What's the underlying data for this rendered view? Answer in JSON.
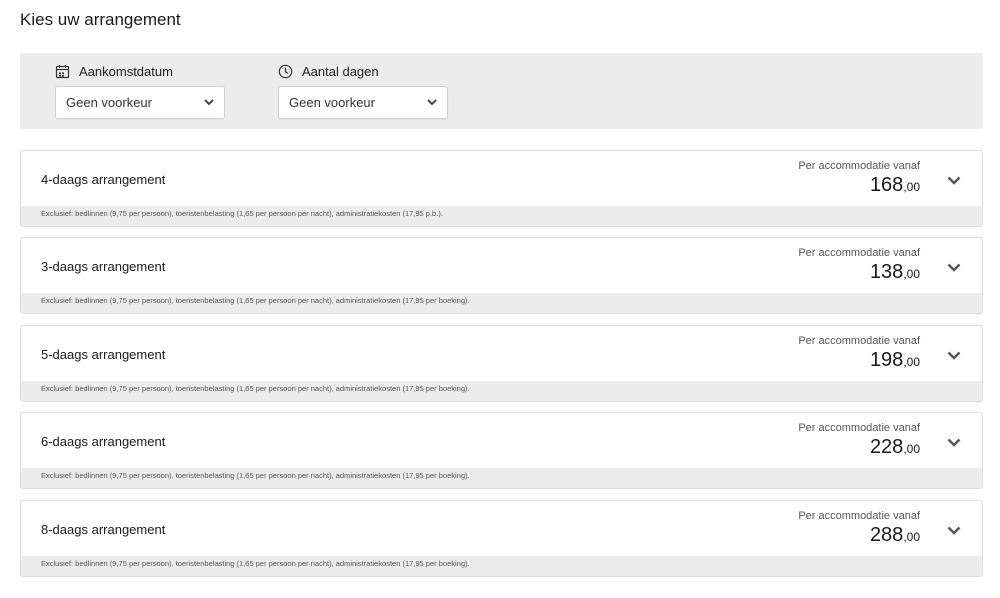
{
  "page": {
    "title": "Kies uw arrangement"
  },
  "filters": {
    "arrival": {
      "label": "Aankomstdatum",
      "icon": "calendar-icon",
      "value": "Geen voorkeur"
    },
    "days": {
      "label": "Aantal dagen",
      "icon": "clock-icon",
      "value": "Geen voorkeur"
    }
  },
  "arrangements": [
    {
      "title": "4-daags arrangement",
      "from_label": "Per accommodatie vanaf",
      "price_main": "168",
      "price_cents": ",00",
      "note": "Exclusief: bedlinnen (9,75 per persoon), toeristenbelasting (1,65 per persoon per nacht), administratiekosten (17,95 p.b.)."
    },
    {
      "title": "3-daags arrangement",
      "from_label": "Per accommodatie vanaf",
      "price_main": "138",
      "price_cents": ",00",
      "note": "Exclusief: bedlinnen (9,75 per persoon), toeristenbelasting (1,65 per persoon per nacht), administratiekosten (17,95 per boeking)."
    },
    {
      "title": "5-daags arrangement",
      "from_label": "Per accommodatie vanaf",
      "price_main": "198",
      "price_cents": ",00",
      "note": "Exclusief: bedlinnen (9,75 per persoon), toeristenbelasting (1,65 per persoon per nacht), administratiekosten (17,95 per boeking)."
    },
    {
      "title": "6-daags arrangement",
      "from_label": "Per accommodatie vanaf",
      "price_main": "228",
      "price_cents": ",00",
      "note": "Exclusief: bedlinnen (9,75 per persoon), toeristenbelasting (1,65 per persoon per nacht), administratiekosten (17,95 per boeking)."
    },
    {
      "title": "8-daags arrangement",
      "from_label": "Per accommodatie vanaf",
      "price_main": "288",
      "price_cents": ",00",
      "note": "Exclusief: bedlinnen (9,75 per persoon), toeristenbelasting (1,65 per persoon per nacht), administratiekosten (17,95 per boeking)."
    }
  ]
}
